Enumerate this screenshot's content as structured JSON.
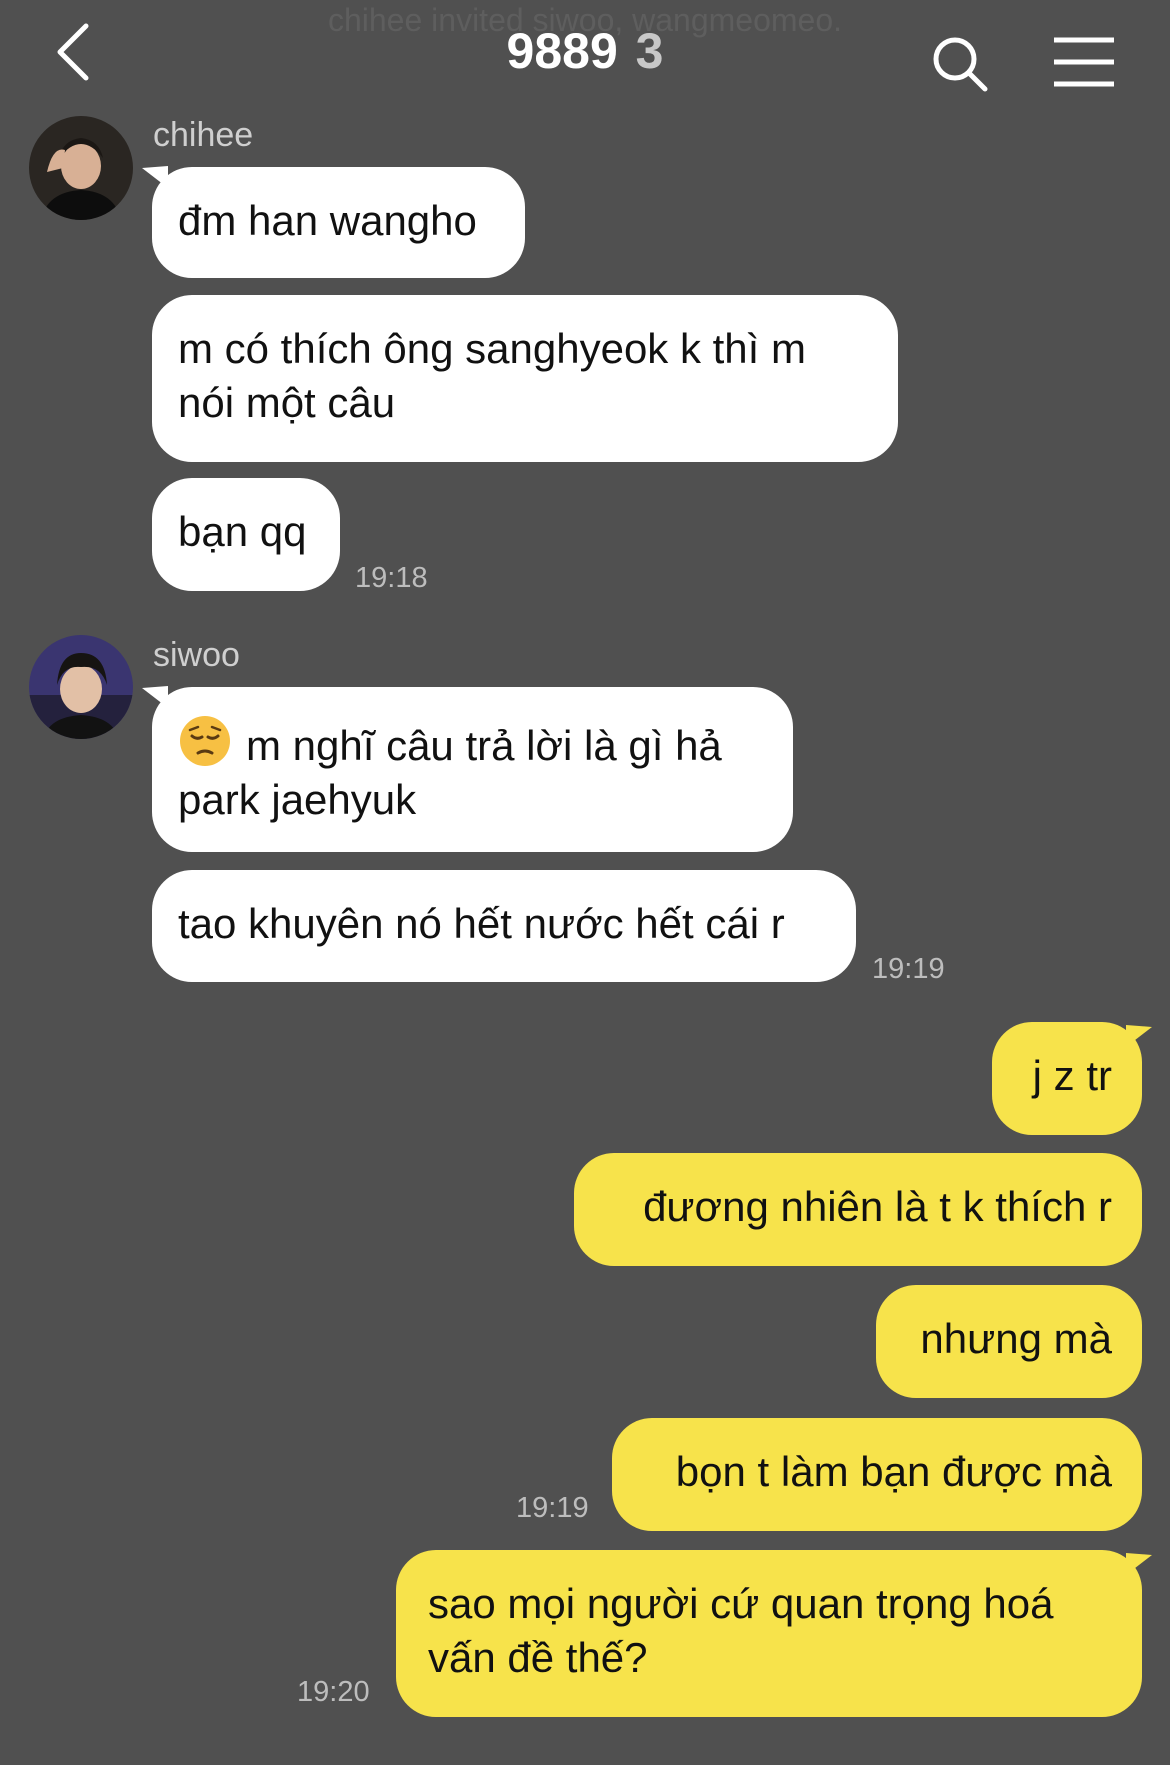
{
  "header": {
    "system_note": "chihee invited siwoo, wangmeomeo.",
    "title": "9889",
    "member_count": "3",
    "back_icon": "chevron-left-icon",
    "search_icon": "search-icon",
    "menu_icon": "menu-icon"
  },
  "messages": {
    "chihee_group": {
      "sender": "chihee",
      "b1": "đm han wangho",
      "b2_line1": "m có thích ông sanghyeok k thì m",
      "b2_line2": "nói một câu",
      "b3": "bạn qq",
      "time": "19:18"
    },
    "siwoo_group": {
      "sender": "siwoo",
      "emoji": "pensive-face-emoji",
      "b1_line1": "m nghĩ câu trả lời là gì hả",
      "b1_line2": "park jaehyuk",
      "b2": "tao khuyên nó hết nước hết cái r",
      "time": "19:19"
    },
    "me_group1": {
      "b1": "j z tr",
      "b2": "đương nhiên là t k thích r",
      "b3": "nhưng mà",
      "b4": "bọn t làm bạn được mà",
      "time": "19:19"
    },
    "me_group2": {
      "b1_line1": "sao mọi người cứ quan trọng hoá",
      "b1_line2": "vấn đề thế?",
      "time": "19:20"
    }
  },
  "colors": {
    "background": "#505050",
    "incoming_bubble": "#ffffff",
    "outgoing_bubble": "#f7e34b"
  }
}
